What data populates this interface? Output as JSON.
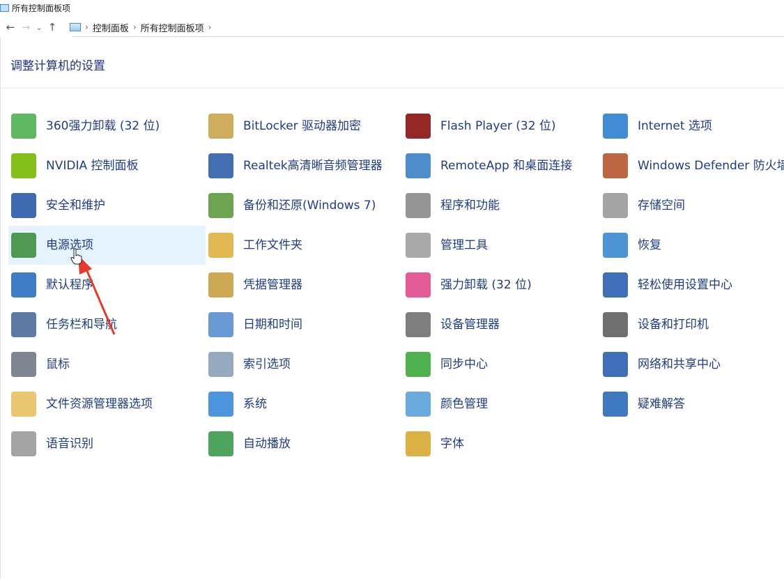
{
  "window": {
    "title": "所有控制面板项"
  },
  "nav": {
    "back": "←",
    "forward": "→",
    "recent": "⌄",
    "up": "↑",
    "breadcrumb": [
      "控制面板",
      "所有控制面板项"
    ],
    "sep": "›"
  },
  "heading": "调整计算机的设置",
  "items": [
    {
      "label": "360强力卸载 (32 位)",
      "icon": "uninstall-360-icon",
      "color": "#4caf50"
    },
    {
      "label": "BitLocker 驱动器加密",
      "icon": "bitlocker-key-icon",
      "color": "#c9a44a"
    },
    {
      "label": "Flash Player (32 位)",
      "icon": "flash-player-icon",
      "color": "#8b0f0f"
    },
    {
      "label": "Internet 选项",
      "icon": "internet-globe-icon",
      "color": "#2e7fd0"
    },
    {
      "label": "NVIDIA 控制面板",
      "icon": "nvidia-icon",
      "color": "#76b900"
    },
    {
      "label": "Realtek高清晰音频管理器",
      "icon": "realtek-audio-icon",
      "color": "#2f5fa8"
    },
    {
      "label": "RemoteApp 和桌面连接",
      "icon": "remoteapp-icon",
      "color": "#3c7fc4"
    },
    {
      "label": "Windows Defender 防火墙",
      "icon": "firewall-icon",
      "color": "#b5552e"
    },
    {
      "label": "安全和维护",
      "icon": "security-flag-icon",
      "color": "#2a5aa8"
    },
    {
      "label": "备份和还原(Windows 7)",
      "icon": "backup-restore-icon",
      "color": "#5c9a3c"
    },
    {
      "label": "程序和功能",
      "icon": "programs-features-icon",
      "color": "#8a8a8a"
    },
    {
      "label": "存储空间",
      "icon": "storage-spaces-icon",
      "color": "#9a9a9a"
    },
    {
      "label": "电源选项",
      "icon": "power-options-icon",
      "color": "#3f8f3f"
    },
    {
      "label": "工作文件夹",
      "icon": "work-folders-icon",
      "color": "#e0b040"
    },
    {
      "label": "管理工具",
      "icon": "admin-tools-icon",
      "color": "#a0a0a0"
    },
    {
      "label": "恢复",
      "icon": "recovery-icon",
      "color": "#3a88d0"
    },
    {
      "label": "默认程序",
      "icon": "default-programs-icon",
      "color": "#2a6fc0"
    },
    {
      "label": "凭据管理器",
      "icon": "credential-manager-icon",
      "color": "#c8a040"
    },
    {
      "label": "强力卸载 (32 位)",
      "icon": "power-uninstall-icon",
      "color": "#e04a8a"
    },
    {
      "label": "轻松使用设置中心",
      "icon": "ease-of-access-icon",
      "color": "#2a5fb0"
    },
    {
      "label": "任务栏和导航",
      "icon": "taskbar-navigation-icon",
      "color": "#4a6c9a"
    },
    {
      "label": "日期和时间",
      "icon": "date-time-icon",
      "color": "#5a8fd0"
    },
    {
      "label": "设备管理器",
      "icon": "device-manager-icon",
      "color": "#707070"
    },
    {
      "label": "设备和打印机",
      "icon": "devices-printers-icon",
      "color": "#606060"
    },
    {
      "label": "鼠标",
      "icon": "mouse-icon",
      "color": "#707a85"
    },
    {
      "label": "索引选项",
      "icon": "indexing-options-icon",
      "color": "#8aa0b8"
    },
    {
      "label": "同步中心",
      "icon": "sync-center-icon",
      "color": "#3caa3c"
    },
    {
      "label": "网络和共享中心",
      "icon": "network-sharing-icon",
      "color": "#2a5fb0"
    },
    {
      "label": "文件资源管理器选项",
      "icon": "explorer-options-icon",
      "color": "#e8c060"
    },
    {
      "label": "系统",
      "icon": "system-icon",
      "color": "#3a8ad8"
    },
    {
      "label": "颜色管理",
      "icon": "color-management-icon",
      "color": "#5aa0d8"
    },
    {
      "label": "疑难解答",
      "icon": "troubleshooting-icon",
      "color": "#2a6ab8"
    },
    {
      "label": "语音识别",
      "icon": "speech-recognition-icon",
      "color": "#9a9a9a"
    },
    {
      "label": "自动播放",
      "icon": "autoplay-icon",
      "color": "#3a9a4a"
    },
    {
      "label": "字体",
      "icon": "fonts-icon",
      "color": "#d8a830"
    }
  ],
  "hovered_index": 12
}
